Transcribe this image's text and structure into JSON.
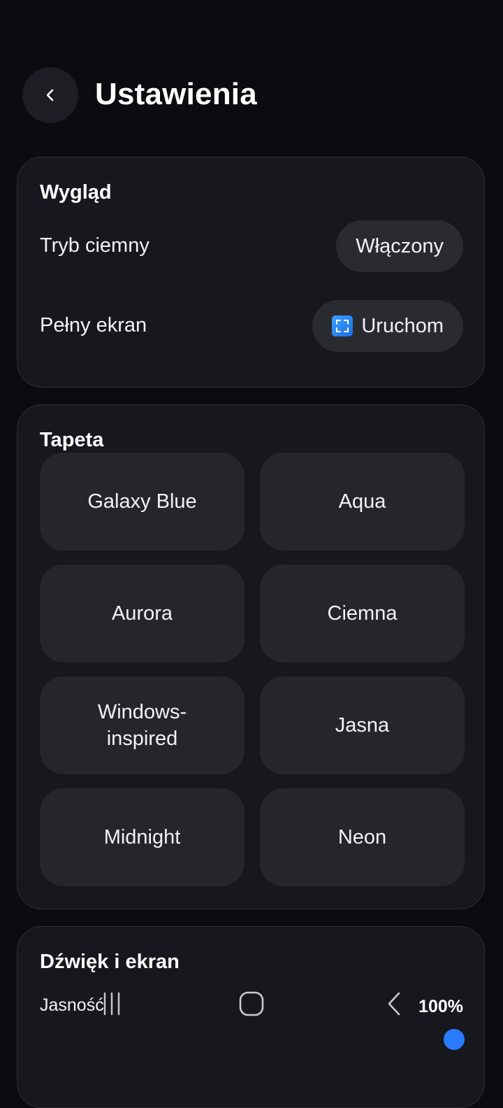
{
  "header": {
    "title": "Ustawienia",
    "back_icon": "chevron-left-icon"
  },
  "appearance": {
    "title": "Wygląd",
    "dark_mode": {
      "label": "Tryb ciemny",
      "value": "Włączony"
    },
    "fullscreen": {
      "label": "Pełny ekran",
      "button_label": "Uruchom",
      "icon": "fullscreen-icon"
    }
  },
  "wallpaper": {
    "title": "Tapeta",
    "options": [
      "Galaxy Blue",
      "Aqua",
      "Aurora",
      "Ciemna",
      "Windows-inspired",
      "Jasna",
      "Midnight",
      "Neon"
    ]
  },
  "sound_screen": {
    "title": "Dźwięk i ekran",
    "brightness": {
      "label": "Jasność",
      "value": "100%"
    }
  },
  "navbar": {
    "recents_icon": "recents-icon",
    "home_icon": "home-icon",
    "back_icon": "back-icon"
  },
  "colors": {
    "background": "#0b0c10",
    "card": "#17181d",
    "tile": "#25262b",
    "accent": "#2b7bff"
  }
}
